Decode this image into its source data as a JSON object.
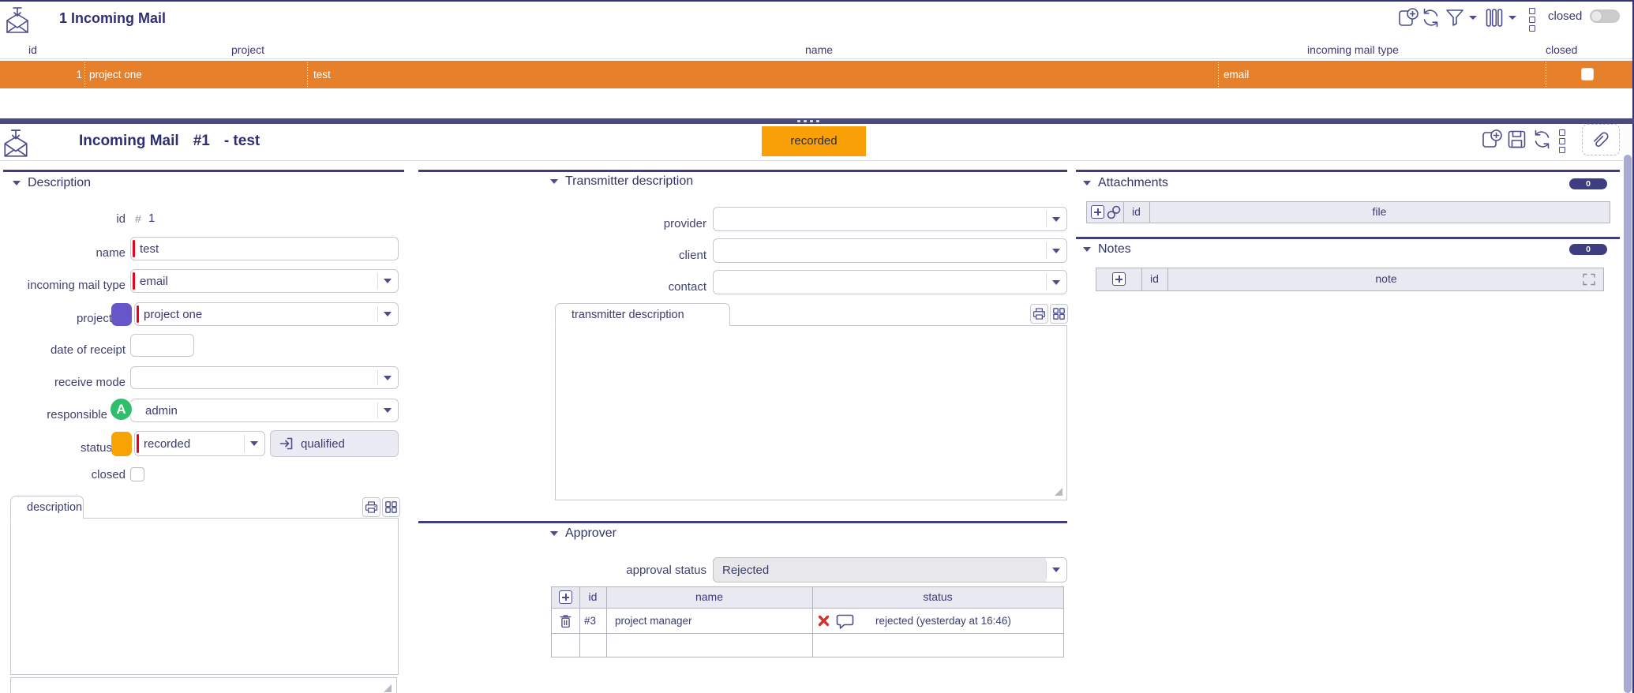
{
  "list": {
    "title": "1 Incoming Mail",
    "toolbar": {
      "closed_label": "closed"
    },
    "headers": {
      "id": "id",
      "project": "project",
      "name": "name",
      "type": "incoming mail type",
      "closed": "closed"
    },
    "row": {
      "id": "1",
      "project": "project one",
      "name": "test",
      "type": "email"
    }
  },
  "form": {
    "title": "Incoming Mail",
    "record_id": "#1",
    "record_suffix": "- test",
    "badge": "recorded",
    "description": {
      "section": "Description",
      "id_label": "id",
      "id_hash": "#",
      "id_value": "1",
      "name_label": "name",
      "name_value": "test",
      "type_label": "incoming mail type",
      "type_value": "email",
      "project_label": "project",
      "project_value": "project one",
      "receipt_label": "date of receipt",
      "receive_label": "receive mode",
      "responsible_label": "responsible",
      "responsible_value": "admin",
      "responsible_initial": "A",
      "status_label": "status",
      "status_value": "recorded",
      "transition_button": "qualified",
      "closed_label": "closed",
      "tab": "description"
    },
    "transmitter": {
      "section": "Transmitter description",
      "provider_label": "provider",
      "client_label": "client",
      "contact_label": "contact",
      "tab": "transmitter description"
    },
    "approver": {
      "section": "Approver",
      "approval_label": "approval status",
      "approval_value": "Rejected",
      "headers": {
        "id": "id",
        "name": "name",
        "status": "status"
      },
      "row": {
        "id": "#3",
        "name": "project manager",
        "status": "rejected (yesterday at 16:46)"
      }
    },
    "attachments": {
      "section": "Attachments",
      "count": "0",
      "headers": {
        "id": "id",
        "file": "file"
      }
    },
    "notes": {
      "section": "Notes",
      "count": "0",
      "headers": {
        "id": "id",
        "note": "note"
      }
    }
  },
  "colors": {
    "accent": "#3d3d80",
    "selection_row": "#e6802a",
    "status_badge": "#f8a005",
    "status_swatch": "#f6a303",
    "project_swatch": "#6557c9",
    "avatar_green": "#2fbf6c",
    "required_red": "#e8001e"
  }
}
